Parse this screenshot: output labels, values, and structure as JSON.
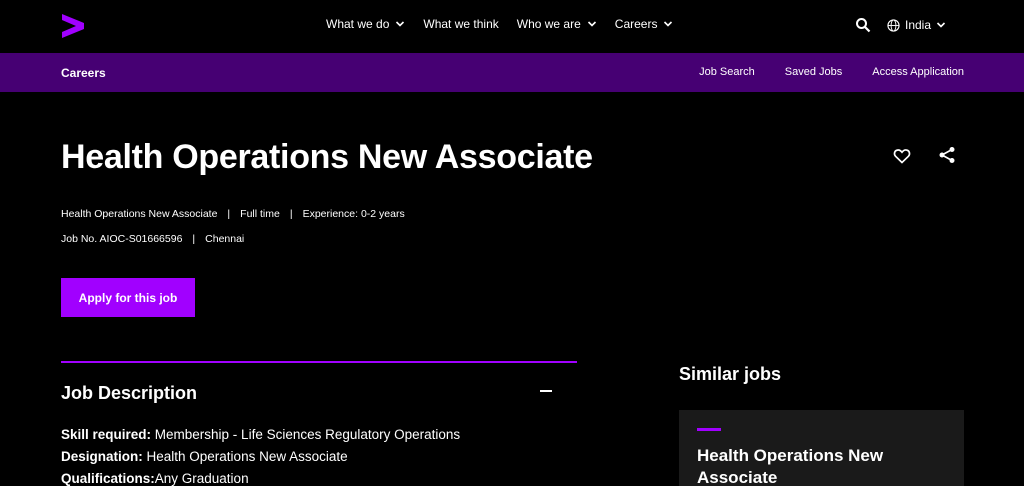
{
  "nav": {
    "items": [
      "What we do",
      "What we think",
      "Who we are",
      "Careers"
    ],
    "country": "India"
  },
  "subnav": {
    "title": "Careers",
    "links": [
      "Job Search",
      "Saved Jobs",
      "Access Application"
    ]
  },
  "job": {
    "title": "Health Operations New Associate",
    "meta1": [
      "Health Operations New Associate",
      "Full time",
      "Experience: 0-2 years"
    ],
    "meta2": [
      "Job No. AIOC-S01666596",
      "Chennai"
    ],
    "apply_label": "Apply for this job"
  },
  "description": {
    "heading": "Job Description",
    "skill_label": "Skill required:",
    "skill_value": " Membership - Life Sciences Regulatory Operations",
    "designation_label": "Designation:",
    "designation_value": " Health Operations New Associate",
    "qualifications_label": "Qualifications:",
    "qualifications_value": "Any Graduation"
  },
  "similar": {
    "heading": "Similar jobs",
    "card_title": "Health Operations New Associate"
  },
  "colors": {
    "accent": "#a100ff",
    "subnav_bg": "#460073",
    "background": "#000000"
  }
}
